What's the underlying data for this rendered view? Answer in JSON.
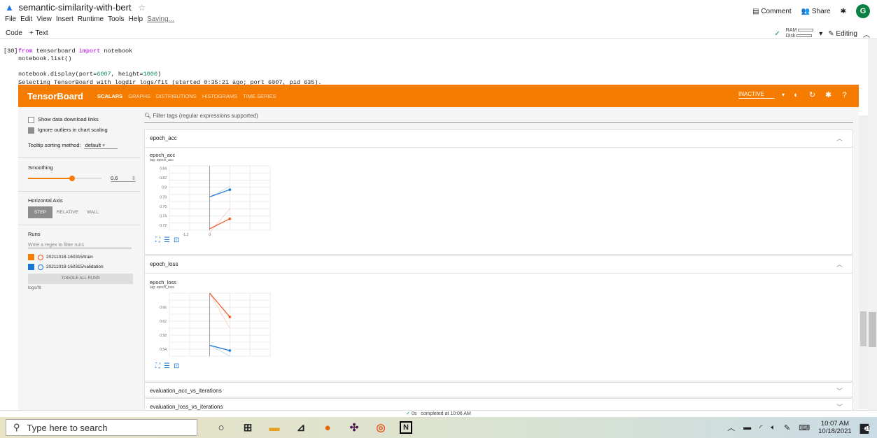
{
  "colab": {
    "title": "semantic-similarity-with-bert",
    "menu": [
      "File",
      "Edit",
      "View",
      "Insert",
      "Runtime",
      "Tools",
      "Help"
    ],
    "saving": "Saving...",
    "comment": "Comment",
    "share": "Share",
    "avatar": "G",
    "code_btn": "Code",
    "text_btn": "+ Text",
    "ram": "RAM",
    "disk": "Disk",
    "editing": "Editing"
  },
  "cell": {
    "lineno": "[30]",
    "line1_kw1": "from",
    "line1_mid": " tensorboard ",
    "line1_kw2": "import",
    "line1_end": " notebook",
    "line2": "notebook.list()",
    "line3_a": "notebook.display(port=",
    "line3_port": "6007",
    "line3_b": ", height=",
    "line3_h": "1000",
    "line3_c": ")",
    "output": "Selecting TensorBoard with logdir logs/fit (started 0:35:21 ago; port 6007, pid 635)."
  },
  "tensorboard": {
    "brand": "TensorBoard",
    "tabs": [
      "SCALARS",
      "GRAPHS",
      "DISTRIBUTIONS",
      "HISTOGRAMS",
      "TIME SERIES"
    ],
    "status": "INACTIVE",
    "sidebar": {
      "show_download": "Show data download links",
      "ignore_outliers": "Ignore outliers in chart scaling",
      "tooltip_label": "Tooltip sorting method:",
      "tooltip_value": "default",
      "smoothing_label": "Smoothing",
      "smoothing_value": "0.6",
      "smoothing": 0.6,
      "haxis_label": "Horizontal Axis",
      "haxis_opts": [
        "STEP",
        "RELATIVE",
        "WALL"
      ],
      "runs_label": "Runs",
      "runs_placeholder": "Write a regex to filter runs",
      "run1": "20211018-160315/train",
      "run2": "20211018-160315/validation",
      "toggle": "TOGGLE ALL RUNS",
      "logdir": "logs/fit"
    },
    "filter_placeholder": "Filter tags (regular expressions supported)",
    "sections": [
      {
        "name": "epoch_acc",
        "card_title": "epoch_acc",
        "card_tag": "tag: epoch_acc"
      },
      {
        "name": "epoch_loss",
        "card_title": "epoch_loss",
        "card_tag": "tag: epoch_loss"
      },
      {
        "name": "evaluation_acc_vs_iterations"
      },
      {
        "name": "evaluation_loss_vs_iterations"
      }
    ],
    "acc_yticks": [
      "0.84",
      "0.82",
      "0.8",
      "0.78",
      "0.76",
      "0.74",
      "0.72"
    ],
    "acc_xticks": [
      "-1.2",
      "0"
    ],
    "loss_yticks": [
      "0.66",
      "0.62",
      "0.58",
      "0.54"
    ]
  },
  "chart_data": [
    {
      "type": "line",
      "title": "epoch_acc",
      "ylim": [
        0.71,
        0.845
      ],
      "xlim": [
        -2,
        3
      ],
      "series": [
        {
          "name": "20211018-160315/validation",
          "color": "#1976d2",
          "x": [
            0,
            1
          ],
          "y": [
            0.78,
            0.795
          ],
          "raw_y": [
            0.78,
            0.802
          ]
        },
        {
          "name": "20211018-160315/train",
          "color": "#f4511e",
          "x": [
            0,
            1
          ],
          "y": [
            0.713,
            0.734
          ],
          "raw_y": [
            0.705,
            0.755
          ]
        }
      ]
    },
    {
      "type": "line",
      "title": "epoch_loss",
      "ylim": [
        0.52,
        0.7
      ],
      "xlim": [
        -2,
        3
      ],
      "series": [
        {
          "name": "20211018-160315/train",
          "color": "#f4511e",
          "x": [
            0,
            1
          ],
          "y": [
            0.7,
            0.632
          ],
          "raw_y": [
            0.7,
            0.6
          ]
        },
        {
          "name": "20211018-160315/validation",
          "color": "#1976d2",
          "x": [
            0,
            1
          ],
          "y": [
            0.551,
            0.536
          ],
          "raw_y": [
            0.551,
            0.52
          ]
        }
      ]
    }
  ],
  "status_bar": {
    "check": "0s",
    "text": "completed at 10:06 AM"
  },
  "taskbar": {
    "search": "Type here to search",
    "time": "10:07 AM",
    "date": "10/18/2021",
    "notif": "16"
  }
}
